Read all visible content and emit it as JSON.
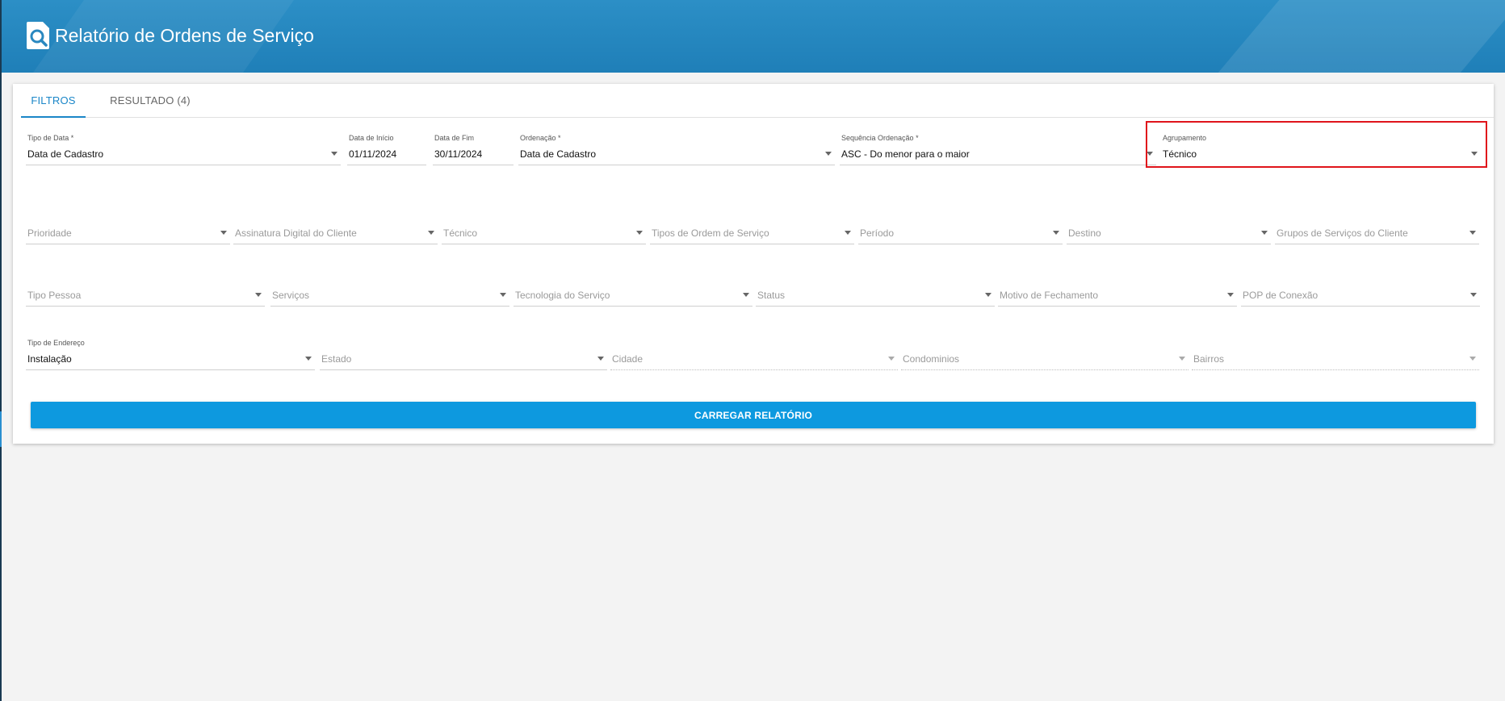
{
  "header": {
    "title": "Relatório de Ordens de Serviço"
  },
  "tabs": [
    {
      "label": "FILTROS",
      "active": true
    },
    {
      "label": "RESULTADO (4)",
      "active": false
    }
  ],
  "row1": {
    "tipo_data": {
      "label": "Tipo de Data *",
      "value": "Data de Cadastro"
    },
    "data_inicio": {
      "label": "Data de Início",
      "value": "01/11/2024"
    },
    "data_fim": {
      "label": "Data de Fim",
      "value": "30/11/2024"
    },
    "ordenacao": {
      "label": "Ordenação *",
      "value": "Data de Cadastro"
    },
    "sequencia": {
      "label": "Sequência Ordenação *",
      "value": "ASC - Do menor para o maior"
    },
    "agrupamento": {
      "label": "Agrupamento",
      "value": "Técnico"
    }
  },
  "row2": {
    "prioridade": {
      "placeholder": "Prioridade"
    },
    "assinatura": {
      "placeholder": "Assinatura Digital do Cliente"
    },
    "tecnico": {
      "placeholder": "Técnico"
    },
    "tipos_os": {
      "placeholder": "Tipos de Ordem de Serviço"
    },
    "periodo": {
      "placeholder": "Período"
    },
    "destino": {
      "placeholder": "Destino"
    },
    "grupos": {
      "placeholder": "Grupos de Serviços do Cliente"
    }
  },
  "row3": {
    "tipo_pessoa": {
      "placeholder": "Tipo Pessoa"
    },
    "servicos": {
      "placeholder": "Serviços"
    },
    "tecnologia": {
      "placeholder": "Tecnologia do Serviço"
    },
    "status": {
      "placeholder": "Status"
    },
    "motivo": {
      "placeholder": "Motivo de Fechamento"
    },
    "pop": {
      "placeholder": "POP de Conexão"
    }
  },
  "row4": {
    "tipo_endereco": {
      "label": "Tipo de Endereço",
      "value": "Instalação"
    },
    "estado": {
      "placeholder": "Estado"
    },
    "cidade": {
      "placeholder": "Cidade"
    },
    "condominios": {
      "placeholder": "Condominios"
    },
    "bairros": {
      "placeholder": "Bairros"
    }
  },
  "actions": {
    "load_label": "CARREGAR RELATÓRIO"
  },
  "colors": {
    "header": "#2c8fc6",
    "accent": "#1a86c8",
    "button": "#0d99df",
    "highlight": "#e0141b"
  }
}
